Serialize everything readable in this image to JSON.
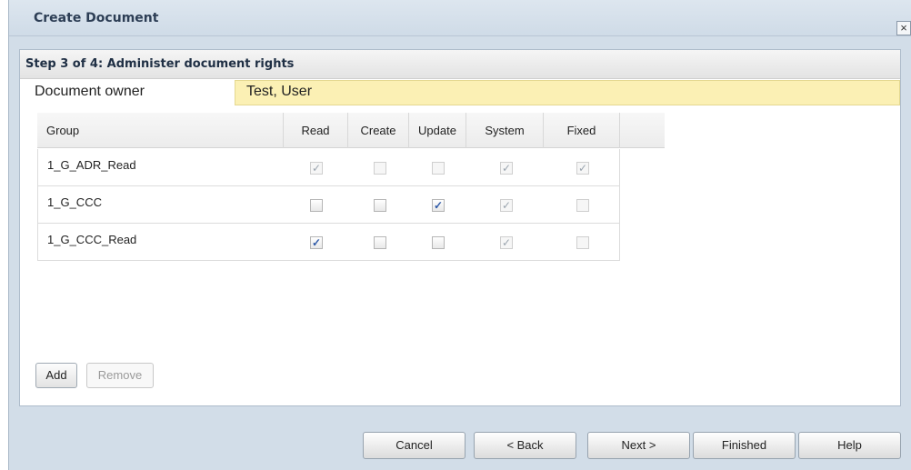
{
  "dialog": {
    "title": "Create Document",
    "close_symbol": "×"
  },
  "panel": {
    "header": "Step 3 of 4: Administer document rights",
    "owner_label": "Document owner",
    "owner_value": "Test, User"
  },
  "grid": {
    "columns": [
      "Group",
      "Read",
      "Create",
      "Update",
      "System",
      "Fixed"
    ],
    "rows": [
      {
        "group": "1_G_ADR_Read",
        "read": {
          "checked": true,
          "enabled": false
        },
        "create": {
          "checked": false,
          "enabled": false
        },
        "update": {
          "checked": false,
          "enabled": false
        },
        "system": {
          "checked": true,
          "enabled": false
        },
        "fixed": {
          "checked": true,
          "enabled": false
        }
      },
      {
        "group": "1_G_CCC",
        "read": {
          "checked": false,
          "enabled": true
        },
        "create": {
          "checked": false,
          "enabled": true
        },
        "update": {
          "checked": true,
          "enabled": true
        },
        "system": {
          "checked": true,
          "enabled": false
        },
        "fixed": {
          "checked": false,
          "enabled": false
        }
      },
      {
        "group": "1_G_CCC_Read",
        "read": {
          "checked": true,
          "enabled": true
        },
        "create": {
          "checked": false,
          "enabled": true
        },
        "update": {
          "checked": false,
          "enabled": true
        },
        "system": {
          "checked": true,
          "enabled": false
        },
        "fixed": {
          "checked": false,
          "enabled": false
        }
      }
    ]
  },
  "actions": {
    "add": "Add",
    "remove": "Remove"
  },
  "footer": {
    "cancel": "Cancel",
    "back": "< Back",
    "next": "Next >",
    "finished": "Finished",
    "help": "Help"
  },
  "colors": {
    "dialog_bg": "#d2dde8",
    "owner_bg": "#fbf0b4",
    "check": "#2f5aa8"
  }
}
